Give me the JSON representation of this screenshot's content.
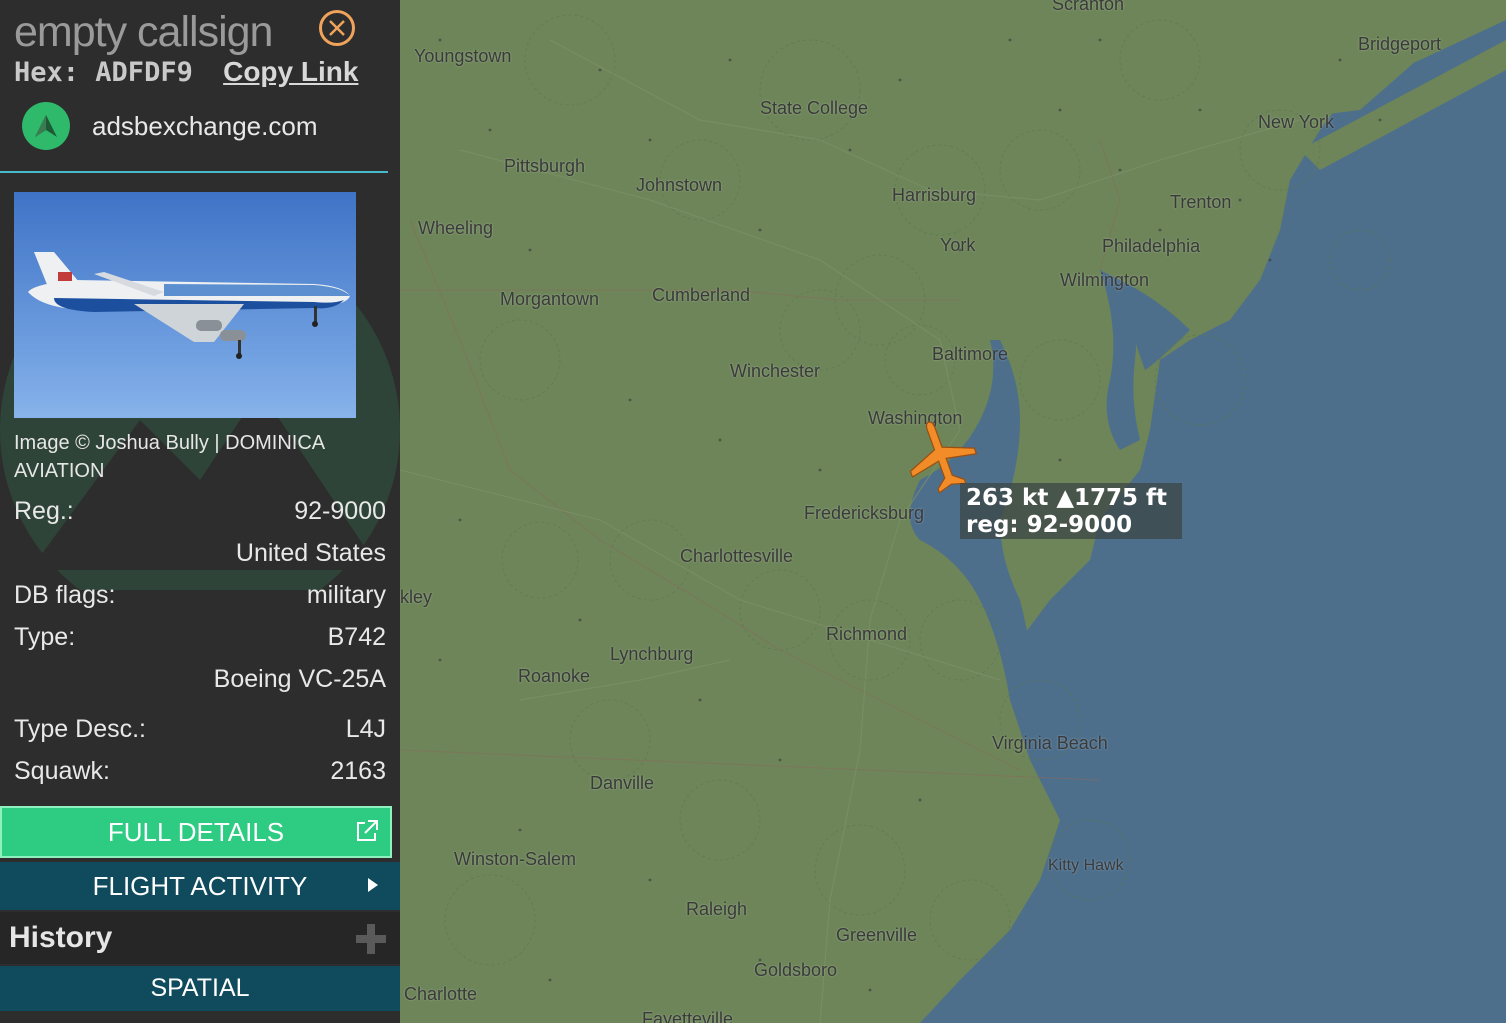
{
  "sidebar": {
    "callsign": "empty callsign",
    "hex_label": "Hex:",
    "hex_value": "ADFDF9",
    "copy_link": "Copy Link",
    "site": "adsbexchange.com",
    "photo_credit": "Image © Joshua Bully | DOMINICA AVIATION",
    "rows": {
      "reg_label": "Reg.:",
      "reg_value": "92-9000",
      "country": "United States",
      "dbflags_label": "DB flags:",
      "dbflags_value": "military",
      "type_label": "Type:",
      "type_value": "B742",
      "type_name": "Boeing VC-25A",
      "typedesc_label": "Type Desc.:",
      "typedesc_value": "L4J",
      "squawk_label": "Squawk:",
      "squawk_value": "2163"
    },
    "full_details": "FULL DETAILS",
    "flight_activity": "FLIGHT ACTIVITY",
    "history": "History",
    "spatial": "SPATIAL"
  },
  "map": {
    "cities": [
      "Scranton",
      "Bridgeport",
      "Youngstown",
      "State College",
      "New York",
      "Pittsburgh",
      "Johnstown",
      "Harrisburg",
      "Trenton",
      "Wheeling",
      "York",
      "Philadelphia",
      "Wilmington",
      "Morgantown",
      "Cumberland",
      "Baltimore",
      "Winchester",
      "Washington",
      "Fredericksburg",
      "Charlottesville",
      "Richmond",
      "Lynchburg",
      "Roanoke",
      "Virginia Beach",
      "Danville",
      "Winston-Salem",
      "Kitty Hawk",
      "Raleigh",
      "Greenville",
      "Goldsboro",
      "Charlotte",
      "Fayetteville",
      "kley"
    ],
    "aircraft": {
      "speed": "263 kt",
      "altitude": "▲1775 ft",
      "reg": "reg: 92-9000",
      "icon": "airplane-icon",
      "color": "#f28c28"
    },
    "colors": {
      "land": "#6d8559",
      "water": "#4d6f8c"
    }
  }
}
